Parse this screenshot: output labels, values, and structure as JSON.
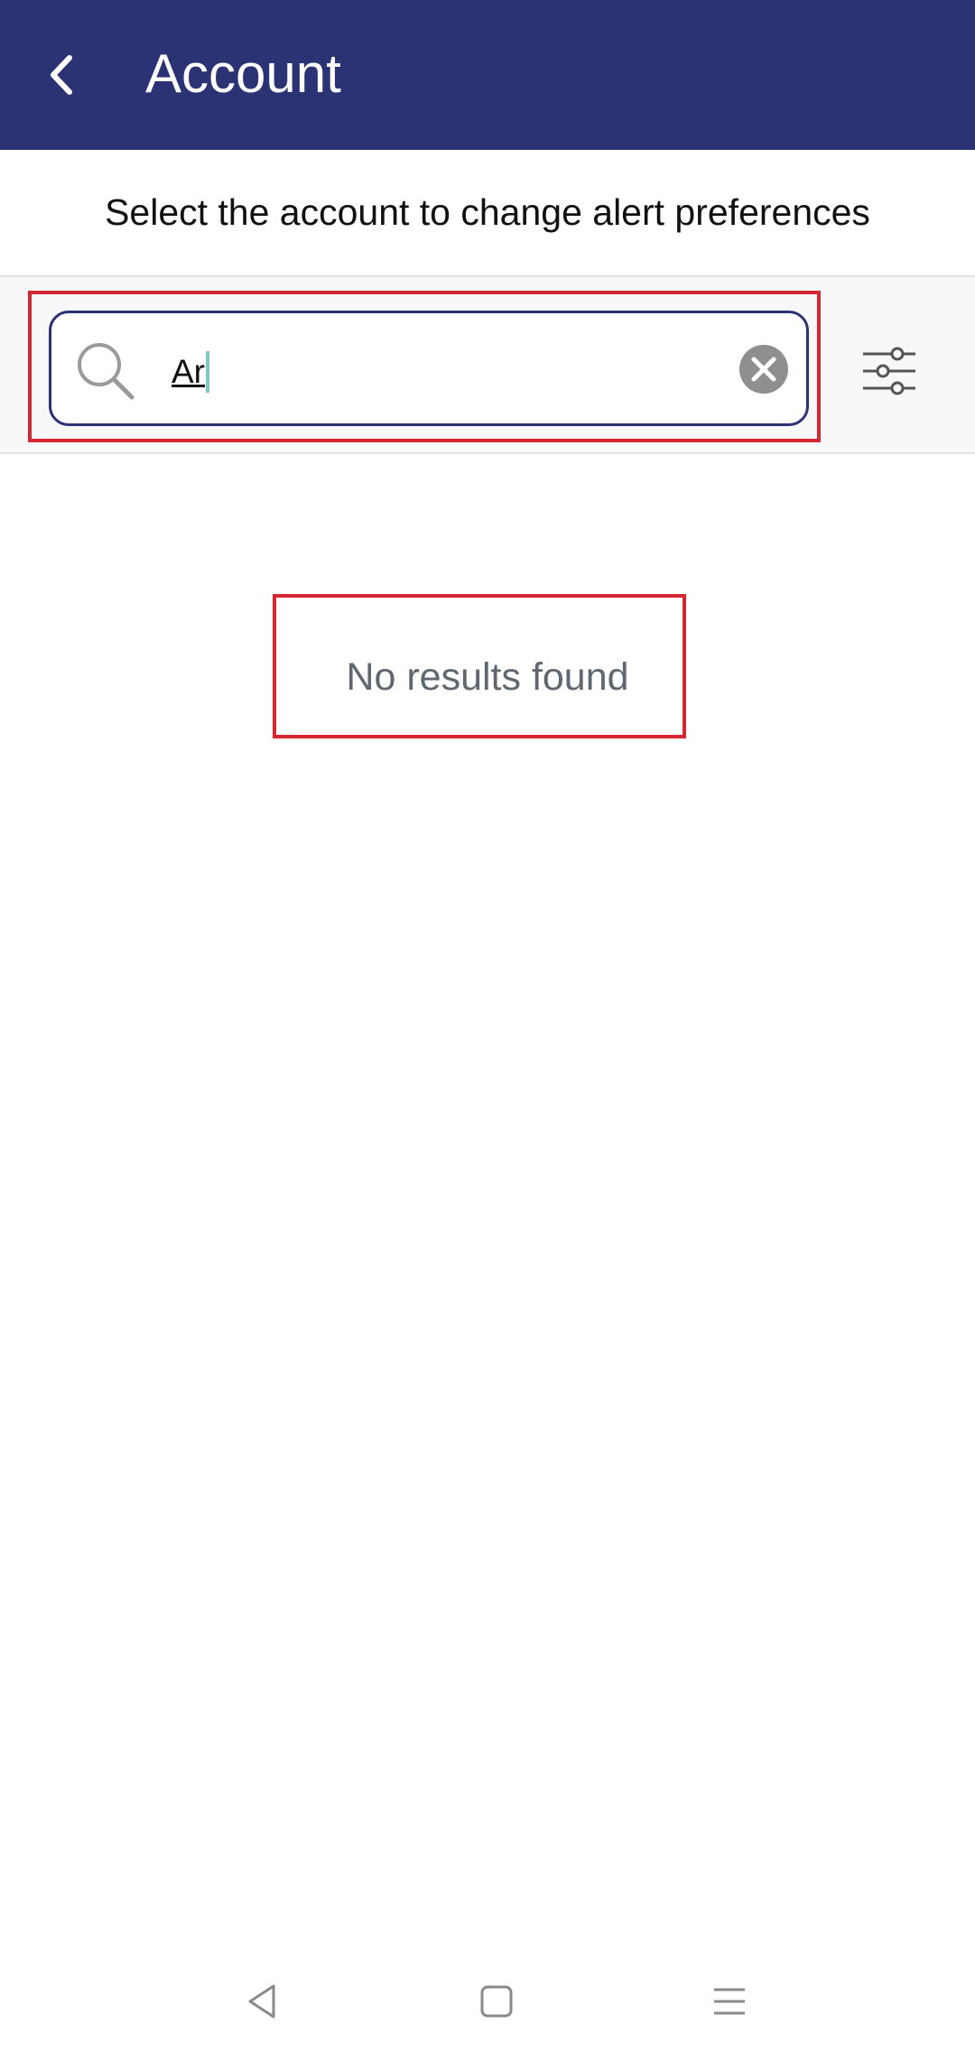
{
  "header": {
    "title": "Account",
    "back_icon": "chevron-left-icon",
    "background_color": "#2c3374"
  },
  "subtitle": "Select the account to change alert preferences",
  "search": {
    "value": "Ar",
    "search_icon": "search-icon",
    "clear_icon": "close-circle-icon",
    "filter_icon": "sliders-icon"
  },
  "results": {
    "empty_message": "No results found"
  },
  "highlight_color": "#d62631",
  "system_nav": {
    "back_icon": "triangle-back-icon",
    "home_icon": "square-home-icon",
    "menu_icon": "menu-lines-icon"
  }
}
